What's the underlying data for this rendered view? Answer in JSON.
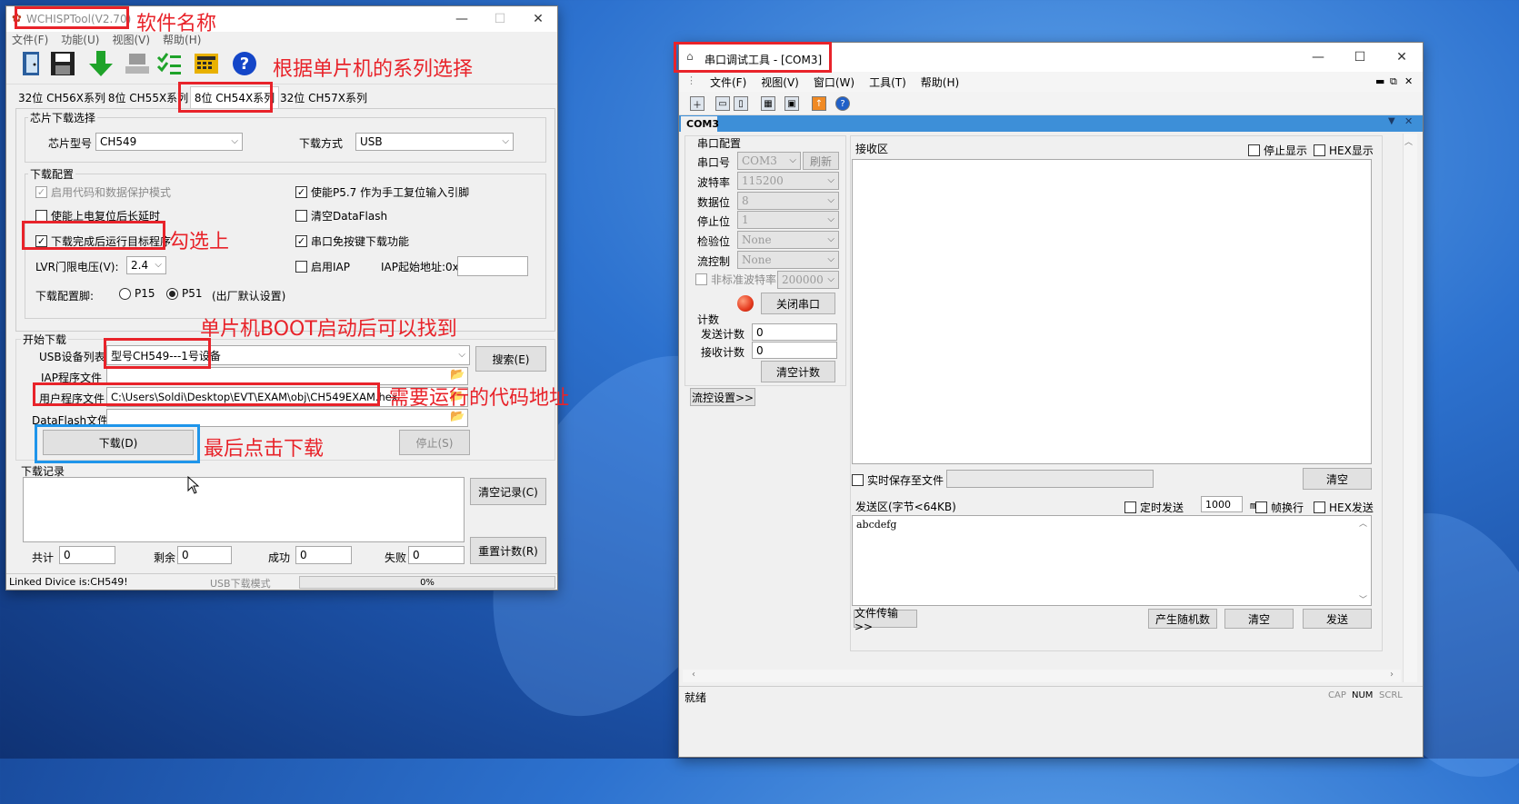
{
  "wchisp": {
    "title": "WCHISPTool(V2.70)",
    "menu": [
      "文件(F)",
      "功能(U)",
      "视图(V)",
      "帮助(H)"
    ],
    "tabs": [
      "32位 CH56X系列",
      "8位 CH55X系列",
      "8位 CH54X系列",
      "32位 CH57X系列"
    ],
    "chip_select": {
      "group": "芯片下载选择",
      "chip_label": "芯片型号",
      "chip_value": "CH549",
      "mode_label": "下载方式",
      "mode_value": "USB"
    },
    "download_config": {
      "group": "下载配置",
      "code_protect": "启用代码和数据保护模式",
      "delay_reset": "使能上电复位后长延时",
      "run_after": "下载完成后运行目标程序",
      "lvr_label": "LVR门限电压(V):",
      "lvr_value": "2.4",
      "pin_label": "下载配置脚:",
      "p15": "P15",
      "p51": "P51",
      "factory": "(出厂默认设置)",
      "p57": "使能P5.7 作为手工复位输入引脚",
      "clear_flash": "清空DataFlash",
      "serial_nokey": "串口免按键下载功能",
      "iap_enable": "启用IAP",
      "iap_addr_label": "IAP起始地址:0x",
      "iap_addr_value": ""
    },
    "start": {
      "group": "开始下载",
      "usb_list_label": "USB设备列表",
      "usb_device": "型号CH549---1号设备",
      "search_btn": "搜索(E)",
      "iap_file_label": "IAP程序文件",
      "iap_file_value": "",
      "user_file_label": "用户程序文件",
      "user_file_value": "C:\\Users\\Soldi\\Desktop\\EVT\\EXAM\\obj\\CH549EXAM.hex",
      "dataflash_label": "DataFlash文件",
      "dataflash_value": "",
      "download_btn": "下载(D)",
      "stop_btn": "停止(S)"
    },
    "log": {
      "group": "下载记录",
      "clear_btn": "清空记录(C)",
      "reset_btn": "重置计数(R)",
      "total_label": "共计",
      "total": "0",
      "remain_label": "剩余",
      "remain": "0",
      "ok_label": "成功",
      "ok": "0",
      "fail_label": "失败",
      "fail": "0"
    },
    "status": {
      "linked": "Linked Divice is:CH549!",
      "mode": "USB下载模式",
      "progress": "0%",
      "progress_value": 0
    }
  },
  "serial": {
    "title": "串口调试工具 - [COM3]",
    "menu": [
      "文件(F)",
      "视图(V)",
      "窗口(W)",
      "工具(T)",
      "帮助(H)"
    ],
    "tab": "COM3",
    "port_config": {
      "group": "串口配置",
      "port_label": "串口号",
      "port_value": "COM3",
      "refresh": "刷新",
      "baud_label": "波特率",
      "baud_value": "115200",
      "data_label": "数据位",
      "data_value": "8",
      "stop_label": "停止位",
      "stop_value": "1",
      "parity_label": "检验位",
      "parity_value": "None",
      "flow_label": "流控制",
      "flow_value": "None",
      "nonstd_label": "非标准波特率",
      "nonstd_value": "200000",
      "close_btn": "关闭串口"
    },
    "counter": {
      "group": "计数",
      "send_label": "发送计数",
      "send_value": "0",
      "recv_label": "接收计数",
      "recv_value": "0",
      "clear_btn": "清空计数"
    },
    "flow_btn": "流控设置>>",
    "receive": {
      "label": "接收区",
      "stop_display": "停止显示",
      "hex_display": "HEX显示",
      "save_file": "实时保存至文件",
      "clear": "清空"
    },
    "send": {
      "label": "发送区(字节<64KB)",
      "timed": "定时发送",
      "interval": "1000",
      "ms": "ms",
      "newline": "帧换行",
      "hex_send": "HEX发送",
      "content": "abcdefg",
      "file_btn": "文件传输>>",
      "random_btn": "产生随机数",
      "clear_btn": "清空",
      "send_btn": "发送"
    },
    "status": {
      "ready": "就绪",
      "cap": "CAP",
      "num": "NUM",
      "scrl": "SCRL"
    }
  },
  "annotations": {
    "software_name": "软件名称",
    "series_select": "根据单片机的系列选择",
    "check_it": "勾选上",
    "boot_found": "单片机BOOT启动后可以找到",
    "code_path": "需要运行的代码地址",
    "click_download": "最后点击下载"
  },
  "colors": {
    "annotation_red": "#e8232a",
    "annotation_blue": "#1f95ea",
    "serial_accent": "#3d8fd8",
    "led_red": "#e53a1e"
  }
}
